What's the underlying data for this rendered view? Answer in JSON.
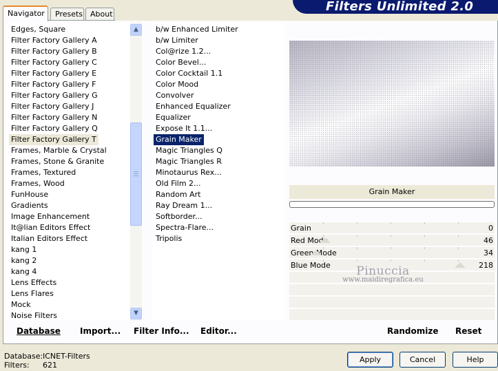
{
  "app": {
    "title": "Filters Unlimited 2.0"
  },
  "tabs": [
    {
      "label": "Navigator",
      "active": true
    },
    {
      "label": "Presets",
      "active": false
    },
    {
      "label": "About",
      "active": false
    }
  ],
  "categories": {
    "items": [
      "Edges, Square",
      "Filter Factory Gallery A",
      "Filter Factory Gallery B",
      "Filter Factory Gallery C",
      "Filter Factory Gallery E",
      "Filter Factory Gallery F",
      "Filter Factory Gallery G",
      "Filter Factory Gallery J",
      "Filter Factory Gallery N",
      "Filter Factory Gallery Q",
      "Filter Factory Gallery T",
      "Frames, Marble & Crystal",
      "Frames, Stone & Granite",
      "Frames, Textured",
      "Frames, Wood",
      "FunHouse",
      "Gradients",
      "Image Enhancement",
      "It@lian Editors Effect",
      "Italian Editors Effect",
      "kang 1",
      "kang 2",
      "kang 4",
      "Lens Effects",
      "Lens Flares",
      "Mock",
      "Noise Filters"
    ],
    "selected": "Filter Factory Gallery T"
  },
  "filters": {
    "items": [
      "b/w Enhanced Limiter",
      "b/w Limiter",
      "Col@rize 1.2...",
      "Color Bevel...",
      "Color Cocktail 1.1",
      "Color Mood",
      "Convolver",
      "Enhanced Equalizer",
      "Equalizer",
      "Expose It 1.1...",
      "Grain Maker",
      "Magic Triangles Q",
      "Magic Triangles R",
      "Minotaurus Rex...",
      "Old Film 2...",
      "Random Art",
      "Ray Dream 1...",
      "Softborder...",
      "Spectra-Flare...",
      "Tripolis"
    ],
    "selected": "Grain Maker"
  },
  "preview": {
    "filter_name": "Grain Maker",
    "progress": 0
  },
  "params": [
    {
      "label": "Grain",
      "value": "0",
      "max": 255
    },
    {
      "label": "Red Mode",
      "value": "46",
      "max": 255
    },
    {
      "label": "Green Mode",
      "value": "34",
      "max": 255
    },
    {
      "label": "Blue Mode",
      "value": "218",
      "max": 255
    }
  ],
  "watermark": {
    "name": "Pinuccia",
    "url": "www.maidiregrafica.eu"
  },
  "toolbar": {
    "database": "Database",
    "import": "Import...",
    "filter_info": "Filter Info...",
    "editor": "Editor...",
    "randomize": "Randomize",
    "reset": "Reset"
  },
  "status": {
    "database_label": "Database:",
    "database_value": "ICNET-Filters",
    "filters_label": "Filters:",
    "filters_value": "621"
  },
  "buttons": {
    "apply": "Apply",
    "cancel": "Cancel",
    "help": "Help"
  },
  "colors": {
    "selection": "#0a246a",
    "banner": "#0a1a6e",
    "tab_accent": "#e68b2c"
  },
  "icons": [
    "scroll-up-arrow-icon",
    "scroll-down-arrow-icon"
  ]
}
